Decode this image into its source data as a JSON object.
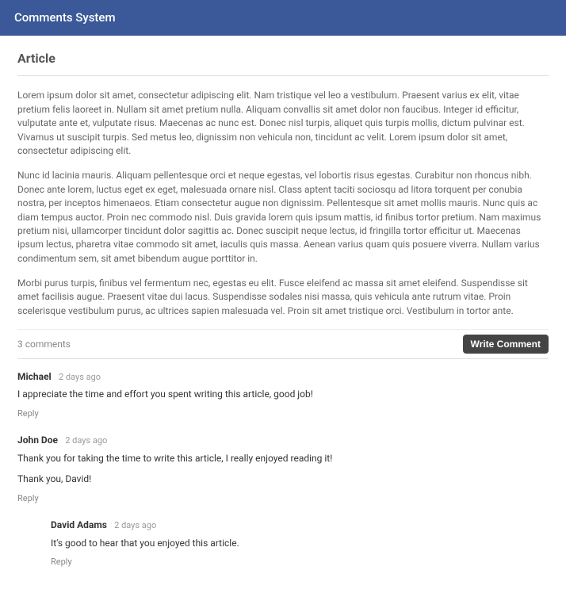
{
  "header": {
    "title": "Comments System"
  },
  "article": {
    "title": "Article",
    "paragraphs": [
      "Lorem ipsum dolor sit amet, consectetur adipiscing elit. Nam tristique vel leo a vestibulum. Praesent varius ex elit, vitae pretium felis laoreet in. Nullam sit amet pretium nulla. Aliquam convallis sit amet dolor non faucibus. Integer id efficitur, vulputate ante et, vulputate risus. Maecenas ac nunc est. Donec nisl turpis, aliquet quis turpis mollis, dictum pulvinar est. Vivamus ut suscipit turpis. Sed metus leo, dignissim non vehicula non, tincidunt ac velit. Lorem ipsum dolor sit amet, consectetur adipiscing elit.",
      "Nunc id lacinia mauris. Aliquam pellentesque orci et neque egestas, vel lobortis risus egestas. Curabitur non rhoncus nibh. Donec ante lorem, luctus eget ex eget, malesuada ornare nisl. Class aptent taciti sociosqu ad litora torquent per conubia nostra, per inceptos himenaeos. Etiam consectetur augue non dignissim. Pellentesque sit amet mollis mauris. Nunc quis ac diam tempus auctor. Proin nec commodo nisl. Duis gravida lorem quis ipsum mattis, id finibus tortor pretium. Nam maximus pretium nisi, ullamcorper tincidunt dolor sagittis ac. Donec suscipit neque lectus, id fringilla tortor efficitur ut. Maecenas ipsum lectus, pharetra vitae commodo sit amet, iaculis quis massa. Aenean varius quam quis posuere viverra. Nullam varius condimentum sem, sit amet bibendum augue porttitor in.",
      "Morbi purus turpis, finibus vel fermentum nec, egestas eu elit. Fusce eleifend ac massa sit amet eleifend. Suspendisse sit amet facilisis augue. Praesent vitae dui lacus. Suspendisse sodales nisi massa, quis vehicula ante rutrum vitae. Proin scelerisque vestibulum purus, ac ultrices sapien malesuada vel. Proin sit amet tristique orci. Vestibulum in tortor ante."
    ]
  },
  "commentsBar": {
    "count_label": "3 comments",
    "write_label": "Write Comment"
  },
  "comments": [
    {
      "author": "Michael",
      "time": "2 days ago",
      "body": [
        "I appreciate the time and effort you spent writing this article, good job!"
      ],
      "reply_label": "Reply",
      "nested": false
    },
    {
      "author": "John Doe",
      "time": "2 days ago",
      "body": [
        "Thank you for taking the time to write this article, I really enjoyed reading it!",
        "Thank you, David!"
      ],
      "reply_label": "Reply",
      "nested": false
    },
    {
      "author": "David Adams",
      "time": "2 days ago",
      "body": [
        "It's good to hear that you enjoyed this article."
      ],
      "reply_label": "Reply",
      "nested": true
    }
  ]
}
